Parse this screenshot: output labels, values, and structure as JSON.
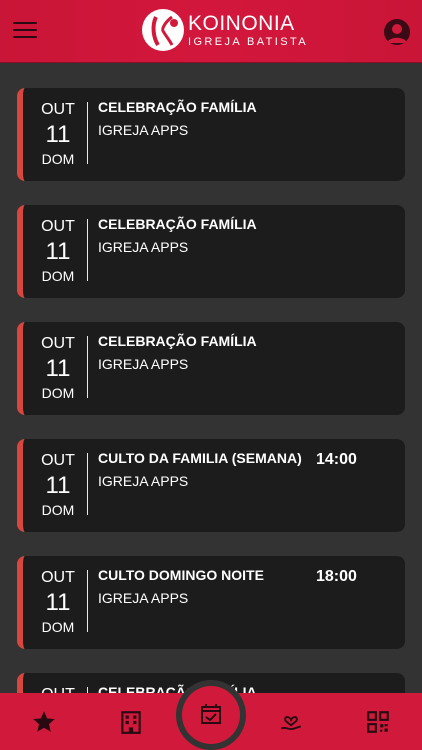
{
  "header": {
    "logo_title": "KOINONIA",
    "logo_subtitle": "IGREJA BATISTA"
  },
  "events": [
    {
      "month": "OUT",
      "day": "11",
      "weekday": "DOM",
      "title": "CELEBRAÇÃO FAMÍLIA",
      "org": "IGREJA APPS",
      "time": ""
    },
    {
      "month": "OUT",
      "day": "11",
      "weekday": "DOM",
      "title": "CELEBRAÇÃO FAMÍLIA",
      "org": "IGREJA APPS",
      "time": ""
    },
    {
      "month": "OUT",
      "day": "11",
      "weekday": "DOM",
      "title": "CELEBRAÇÃO FAMÍLIA",
      "org": "IGREJA APPS",
      "time": ""
    },
    {
      "month": "OUT",
      "day": "11",
      "weekday": "DOM",
      "title": "CULTO DA FAMILIA (SEMANA)",
      "org": "IGREJA APPS",
      "time": "14:00"
    },
    {
      "month": "OUT",
      "day": "11",
      "weekday": "DOM",
      "title": "CULTO DOMINGO NOITE",
      "org": "IGREJA APPS",
      "time": "18:00"
    },
    {
      "month": "OUT",
      "day": "",
      "weekday": "",
      "title": "CELEBRAÇÃO FAMÍLIA",
      "org": "",
      "time": ""
    }
  ],
  "tabs": [
    {
      "icon": "star-icon"
    },
    {
      "icon": "building-icon"
    },
    {
      "icon": "calendar-check-icon"
    },
    {
      "icon": "hand-heart-icon"
    },
    {
      "icon": "qr-code-icon"
    }
  ],
  "colors": {
    "brand_red": "#d11a3b",
    "card_accent": "#d8473f",
    "card_bg": "#1c1c1c",
    "page_bg": "#333333"
  }
}
